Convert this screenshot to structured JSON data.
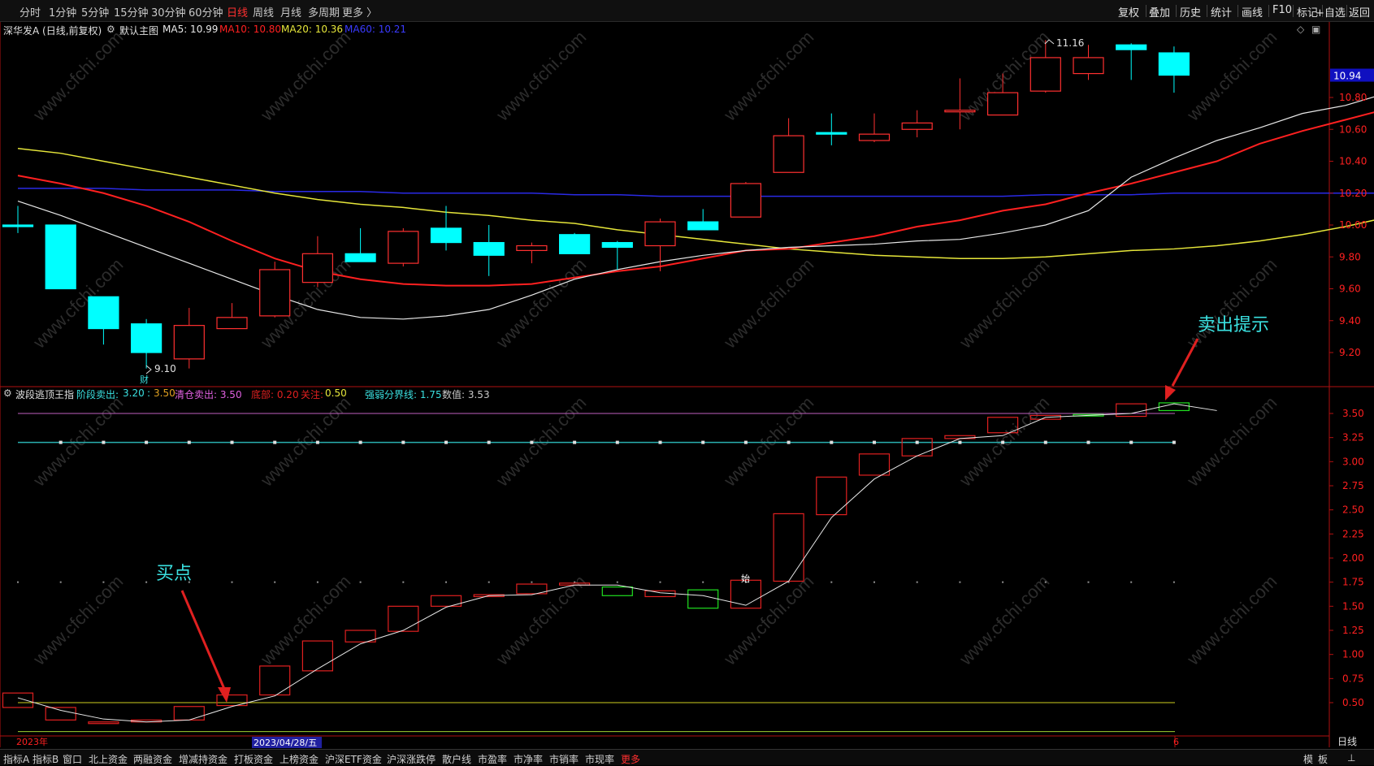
{
  "toolbar": {
    "periods": [
      "分时",
      "1分钟",
      "5分钟",
      "15分钟",
      "30分钟",
      "60分钟",
      "日线",
      "周线",
      "月线",
      "多周期",
      "更多 〉"
    ],
    "active_period": "日线",
    "right": [
      "复权",
      "叠加",
      "历史",
      "统计",
      "画线",
      "F10",
      "标记",
      "+自选",
      "返回"
    ]
  },
  "main_header": {
    "stock": "深华发A (日线,前复权)",
    "chart_name": "默认主图",
    "ma5": "MA5: 10.99",
    "ma10": "MA10: 10.80",
    "ma20": "MA20: 10.36",
    "ma60": "MA60: 10.21"
  },
  "indicator_header": {
    "name": "波段逃顶王指",
    "stage_label": "阶段卖出:",
    "stage_v1": "3.20",
    "stage_sep": ":",
    "stage_v2": "3.50",
    "clear_label": "清仓卖出: 3.50",
    "bottom_label": "底部: 0.20",
    "watch_label": "关注:",
    "watch_val": "0.50",
    "boundary_label": "强弱分界线: 1.75",
    "value_label": "数值: 3.53"
  },
  "annotations": {
    "buy": "买点",
    "sell": "卖出提示",
    "high_label": "11.16",
    "low_label": "9.10",
    "cai": "财",
    "shi": "始"
  },
  "axis": {
    "price_ticks": [
      "10.80",
      "10.60",
      "10.40",
      "10.20",
      "10.00",
      "9.80",
      "9.60",
      "9.40",
      "9.20"
    ],
    "current_price": "10.94",
    "ind_ticks": [
      "3.50",
      "3.25",
      "3.00",
      "2.75",
      "2.50",
      "2.25",
      "2.00",
      "1.75",
      "1.50",
      "1.25",
      "1.00",
      "0.75",
      "0.50"
    ],
    "x_start_label": "2023年",
    "x_date_label": "2023/04/28/五",
    "x_end_label": "6",
    "period_label": "日线"
  },
  "bottom_tabs": [
    "指标A",
    "指标B",
    "窗口",
    "北上资金",
    "两融资金",
    "增减持资金",
    "打板资金",
    "上榜资金",
    "沪深ETF资金",
    "沪深涨跌停",
    "散户线",
    "市盈率",
    "市净率",
    "市销率",
    "市现率",
    "更多"
  ],
  "bottom_right": [
    "模",
    "板",
    "⊥"
  ],
  "watermark": "www.cfchi.com",
  "colors": {
    "up": "#ff3030",
    "down": "#00ffff",
    "ma5": "#e8e8e8",
    "ma10": "#ff2020",
    "ma20": "#e6e63a",
    "ma60": "#2a2ae6",
    "ind_up": "#e02020",
    "ind_down": "#20e020",
    "accent": "#3ae0e0"
  },
  "chart_data": [
    {
      "type": "candlestick",
      "title": "深华发A (日线,前复权)",
      "ylim": [
        9.1,
        11.25
      ],
      "candles": [
        {
          "o": 10.0,
          "h": 10.12,
          "l": 9.95,
          "c": 9.99
        },
        {
          "o": 10.0,
          "h": 10.0,
          "l": 9.6,
          "c": 9.6
        },
        {
          "o": 9.55,
          "h": 9.55,
          "l": 9.25,
          "c": 9.35
        },
        {
          "o": 9.38,
          "h": 9.41,
          "l": 9.1,
          "c": 9.2
        },
        {
          "o": 9.16,
          "h": 9.48,
          "l": 9.1,
          "c": 9.37
        },
        {
          "o": 9.35,
          "h": 9.51,
          "l": 9.35,
          "c": 9.42
        },
        {
          "o": 9.43,
          "h": 9.77,
          "l": 9.42,
          "c": 9.72
        },
        {
          "o": 9.64,
          "h": 9.93,
          "l": 9.61,
          "c": 9.82
        },
        {
          "o": 9.82,
          "h": 9.98,
          "l": 9.77,
          "c": 9.77
        },
        {
          "o": 9.76,
          "h": 9.98,
          "l": 9.74,
          "c": 9.96
        },
        {
          "o": 9.98,
          "h": 10.12,
          "l": 9.84,
          "c": 9.89
        },
        {
          "o": 9.89,
          "h": 10.0,
          "l": 9.68,
          "c": 9.81
        },
        {
          "o": 9.84,
          "h": 9.89,
          "l": 9.76,
          "c": 9.87
        },
        {
          "o": 9.94,
          "h": 9.95,
          "l": 9.83,
          "c": 9.82
        },
        {
          "o": 9.89,
          "h": 9.9,
          "l": 9.72,
          "c": 9.86
        },
        {
          "o": 9.87,
          "h": 10.04,
          "l": 9.71,
          "c": 10.02
        },
        {
          "o": 10.02,
          "h": 10.1,
          "l": 10.0,
          "c": 9.97
        },
        {
          "o": 10.05,
          "h": 10.27,
          "l": 10.05,
          "c": 10.26
        },
        {
          "o": 10.33,
          "h": 10.67,
          "l": 10.34,
          "c": 10.56
        },
        {
          "o": 10.58,
          "h": 10.7,
          "l": 10.5,
          "c": 10.57
        },
        {
          "o": 10.53,
          "h": 10.7,
          "l": 10.52,
          "c": 10.57
        },
        {
          "o": 10.6,
          "h": 10.72,
          "l": 10.55,
          "c": 10.64
        },
        {
          "o": 10.72,
          "h": 10.92,
          "l": 10.6,
          "c": 10.72
        },
        {
          "o": 10.69,
          "h": 10.95,
          "l": 10.7,
          "c": 10.83
        },
        {
          "o": 10.84,
          "h": 11.16,
          "l": 10.83,
          "c": 11.05
        },
        {
          "o": 10.95,
          "h": 11.13,
          "l": 10.91,
          "c": 11.05
        },
        {
          "o": 11.13,
          "h": 11.14,
          "l": 10.91,
          "c": 11.1
        },
        {
          "o": 11.08,
          "h": 11.12,
          "l": 10.83,
          "c": 10.94
        }
      ],
      "ma5": [
        10.15,
        10.06,
        9.96,
        9.86,
        9.76,
        9.66,
        9.56,
        9.47,
        9.42,
        9.41,
        9.43,
        9.47,
        9.56,
        9.66,
        9.72,
        9.77,
        9.81,
        9.84,
        9.86,
        9.87,
        9.88,
        9.9,
        9.91,
        9.95,
        10.0,
        10.09,
        10.3,
        10.42,
        10.53,
        10.61,
        10.7,
        10.75,
        10.83,
        10.88,
        10.94,
        10.99,
        11.05
      ],
      "ma10": [
        10.31,
        10.26,
        10.2,
        10.12,
        10.02,
        9.9,
        9.79,
        9.71,
        9.66,
        9.63,
        9.62,
        9.62,
        9.63,
        9.67,
        9.71,
        9.74,
        9.79,
        9.84,
        9.85,
        9.89,
        9.93,
        9.99,
        10.03,
        10.09,
        10.13,
        10.2,
        10.26,
        10.33,
        10.4,
        10.51,
        10.59,
        10.66,
        10.73,
        10.8
      ],
      "ma20": [
        10.48,
        10.45,
        10.4,
        10.35,
        10.3,
        10.25,
        10.2,
        10.16,
        10.13,
        10.11,
        10.08,
        10.06,
        10.03,
        10.01,
        9.97,
        9.94,
        9.91,
        9.88,
        9.85,
        9.83,
        9.81,
        9.8,
        9.79,
        9.79,
        9.8,
        9.82,
        9.84,
        9.85,
        9.87,
        9.9,
        9.94,
        9.99,
        10.05,
        10.1,
        10.15,
        10.21,
        10.26,
        10.31,
        10.36
      ],
      "ma60": [
        10.23,
        10.23,
        10.23,
        10.22,
        10.22,
        10.22,
        10.21,
        10.21,
        10.21,
        10.2,
        10.2,
        10.2,
        10.2,
        10.19,
        10.19,
        10.18,
        10.18,
        10.18,
        10.18,
        10.18,
        10.18,
        10.18,
        10.18,
        10.18,
        10.19,
        10.19,
        10.19,
        10.2,
        10.2,
        10.2,
        10.2,
        10.2,
        10.2,
        10.2,
        10.21,
        10.21,
        10.21,
        10.21
      ]
    },
    {
      "type": "indicator",
      "title": "波段逃顶王指",
      "ylim": [
        0.2,
        3.75
      ],
      "bars": [
        {
          "o": 0.45,
          "c": 0.6
        },
        {
          "o": 0.32,
          "c": 0.45
        },
        {
          "o": 0.3,
          "c": 0.3
        },
        {
          "o": 0.3,
          "c": 0.32
        },
        {
          "o": 0.32,
          "c": 0.46
        },
        {
          "o": 0.47,
          "c": 0.58
        },
        {
          "o": 0.58,
          "c": 0.88
        },
        {
          "o": 0.83,
          "c": 1.14
        },
        {
          "o": 1.13,
          "c": 1.25
        },
        {
          "o": 1.24,
          "c": 1.5
        },
        {
          "o": 1.5,
          "c": 1.61
        },
        {
          "o": 1.6,
          "c": 1.62
        },
        {
          "o": 1.63,
          "c": 1.73
        },
        {
          "o": 1.72,
          "c": 1.74
        },
        {
          "o": 1.7,
          "c": 1.61
        },
        {
          "o": 1.6,
          "c": 1.66
        },
        {
          "o": 1.67,
          "c": 1.48
        },
        {
          "o": 1.48,
          "c": 1.77
        },
        {
          "o": 1.76,
          "c": 2.46
        },
        {
          "o": 2.45,
          "c": 2.84
        },
        {
          "o": 2.86,
          "c": 3.08
        },
        {
          "o": 3.06,
          "c": 3.24
        },
        {
          "o": 3.24,
          "c": 3.27
        },
        {
          "o": 3.3,
          "c": 3.46
        },
        {
          "o": 3.44,
          "c": 3.48
        },
        {
          "o": 3.49,
          "c": 3.48
        },
        {
          "o": 3.47,
          "c": 3.6
        },
        {
          "o": 3.61,
          "c": 3.53
        }
      ],
      "line": [
        0.55,
        0.42,
        0.33,
        0.3,
        0.32,
        0.46,
        0.57,
        0.85,
        1.11,
        1.25,
        1.49,
        1.61,
        1.62,
        1.72,
        1.72,
        1.64,
        1.61,
        1.51,
        1.76,
        2.42,
        2.82,
        3.06,
        3.24,
        3.27,
        3.46,
        3.48,
        3.5,
        3.6,
        3.53
      ],
      "levels": {
        "stage_sell": 3.2,
        "clear_sell": 3.5,
        "bottom": 0.2,
        "watch": 0.5,
        "boundary": 1.75
      }
    }
  ]
}
